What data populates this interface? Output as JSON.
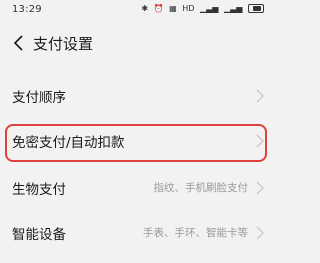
{
  "status_bar": {
    "time": "13:29",
    "icons": [
      "bluetooth-icon",
      "alarm-icon",
      "network-speed-icon",
      "volte-icon",
      "signal-icon",
      "signal-icon",
      "battery-icon"
    ],
    "network_text": "HD",
    "signal_text": "⁵ᴳ",
    "battery_label": "60"
  },
  "header": {
    "title": "支付设置"
  },
  "settings": [
    {
      "label": "支付顺序",
      "value": ""
    },
    {
      "label": "免密支付/自动扣款",
      "value": ""
    },
    {
      "label": "生物支付",
      "value": "指纹、手机刷脸支付"
    },
    {
      "label": "智能设备",
      "value": "手表、手环、智能卡等"
    }
  ],
  "colors": {
    "background": "#f2f2f2",
    "highlight": "#e0413c",
    "secondary_text": "#999999"
  }
}
